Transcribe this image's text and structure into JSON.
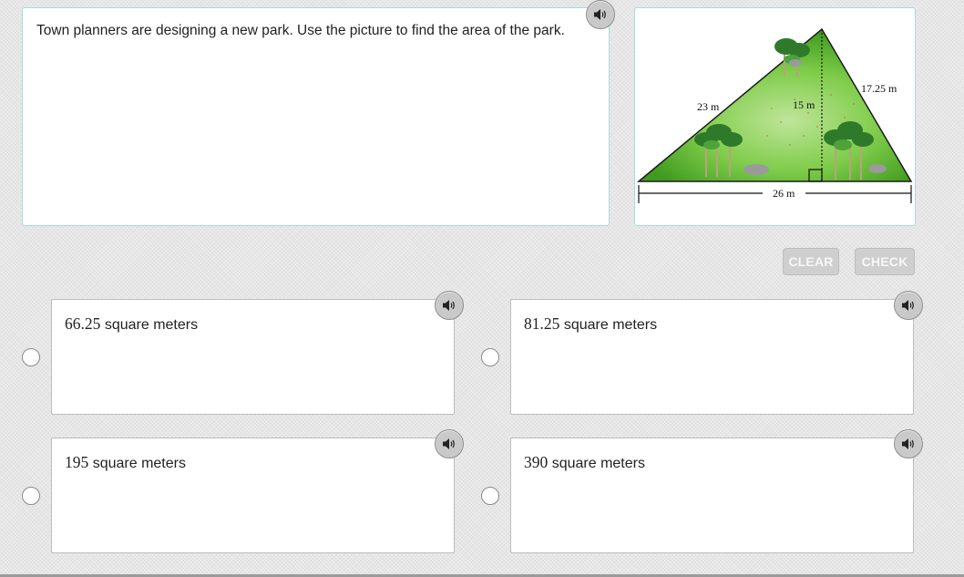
{
  "question": {
    "text": "Town planners are designing a new park. Use the picture to find the area of the park."
  },
  "figure": {
    "labels": {
      "left_side": "23 m",
      "right_side": "17.25 m",
      "height": "15 m",
      "base": "26 m"
    }
  },
  "buttons": {
    "clear": "CLEAR",
    "check": "CHECK"
  },
  "choices": [
    {
      "number": "66.25",
      "unit": "square meters"
    },
    {
      "number": "81.25",
      "unit": "square meters"
    },
    {
      "number": "195",
      "unit": "square meters"
    },
    {
      "number": "390",
      "unit": "square meters"
    }
  ],
  "icons": {
    "audio": "speaker-icon",
    "radio": "radio-button"
  },
  "colors": {
    "panel_border": "#a9dbe0",
    "button_disabled": "#cfcfcf",
    "park_green": "#5cb531"
  }
}
